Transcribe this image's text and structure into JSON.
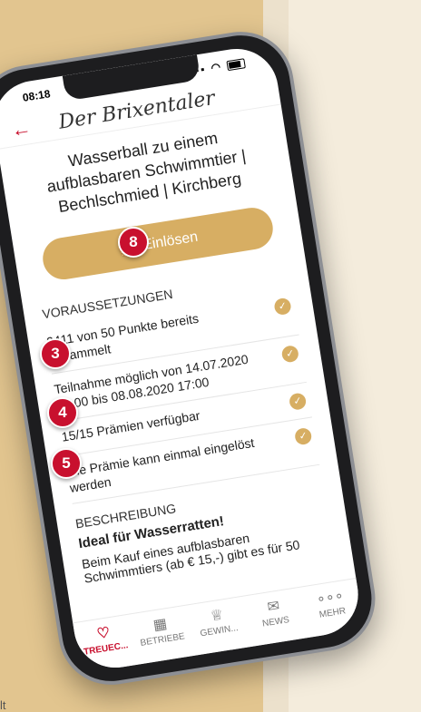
{
  "status_bar": {
    "time": "08:18",
    "icons": "▪▪ ◠"
  },
  "header": {
    "logo_text": "Der Brixentaler",
    "back_label": "←"
  },
  "reward": {
    "title": "Wasserball zu einem aufblasbaren Schwimmtier | Bechlschmied | Kirchberg",
    "redeem_label": "Einlösen"
  },
  "requirements": {
    "title": "VORAUSSETZUNGEN",
    "items": [
      {
        "text": "2411 von 50 Punkte bereits gesammelt"
      },
      {
        "text": "Teilnahme möglich von 14.07.2020 08:00 bis 08.08.2020 17:00"
      },
      {
        "text": "15/15 Prämien verfügbar"
      },
      {
        "text": "Die Prämie kann einmal eingelöst werden"
      }
    ]
  },
  "description": {
    "title": "BESCHREIBUNG",
    "headline": "Ideal für Wasserratten!",
    "text": "Beim Kauf eines aufblasbaren Schwimmtiers (ab € 15,-) gibt es für 50"
  },
  "tabbar": {
    "items": [
      {
        "label": "TREUEC...",
        "icon": "♡"
      },
      {
        "label": "BETRIEBE",
        "icon": "▦"
      },
      {
        "label": "GEWIN...",
        "icon": "♕"
      },
      {
        "label": "NEWS",
        "icon": "✉"
      },
      {
        "label": "MEHR",
        "icon": "∘∘∘"
      }
    ]
  },
  "badges": {
    "b8": "8",
    "b3": "3",
    "b4": "4",
    "b5": "5"
  },
  "bottom_text": "lt",
  "colors": {
    "accent": "#c8102e",
    "gold": "#d7ae63",
    "background_left": "#e2c58f"
  }
}
